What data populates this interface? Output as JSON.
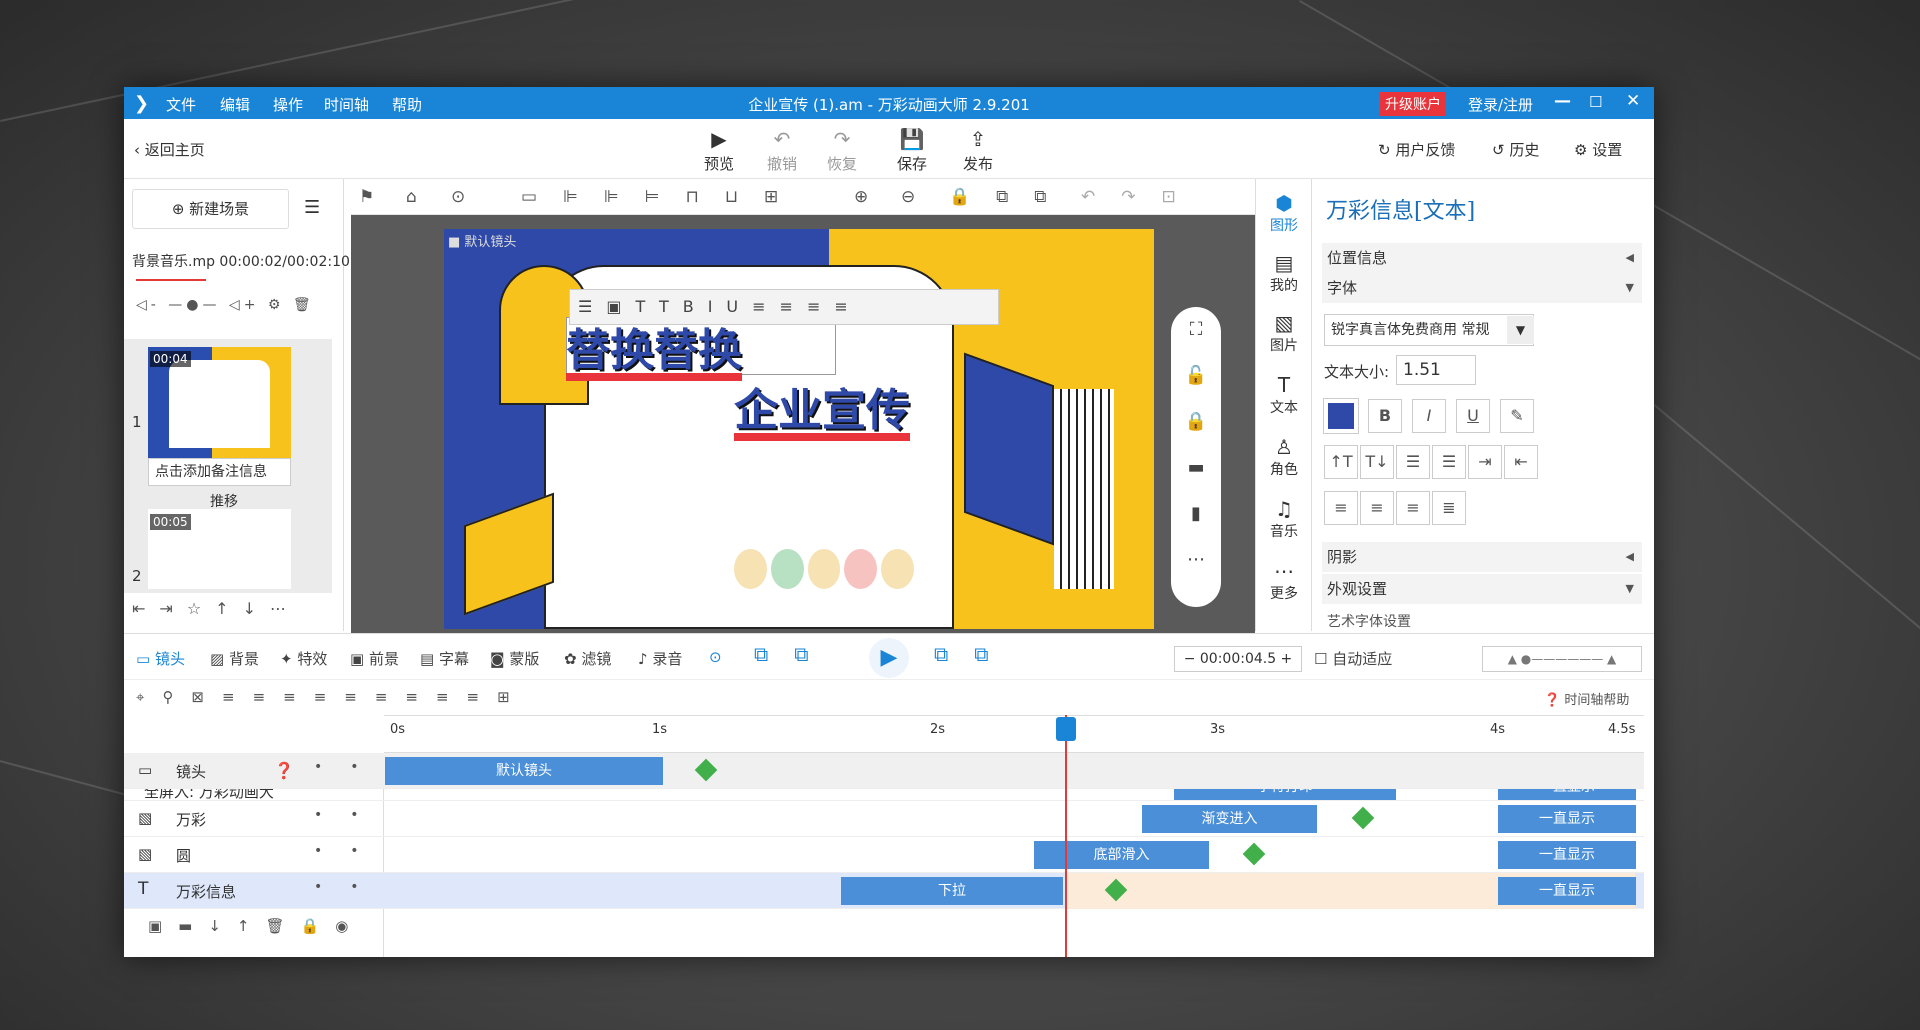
{
  "titlebar": {
    "menu": [
      "文件",
      "编辑",
      "操作",
      "时间轴",
      "帮助"
    ],
    "title": "企业宣传 (1).am - 万彩动画大师 2.9.201",
    "upgrade": "升级账户",
    "login": "登录/注册",
    "minimize": "—",
    "maximize": "☐",
    "close": "✕"
  },
  "toolbar": {
    "back": "返回主页",
    "preview": "预览",
    "undo": "撤销",
    "redo": "恢复",
    "save": "保存",
    "publish": "发布",
    "feedback": "用户反馈",
    "history": "历史",
    "settings": "设置"
  },
  "left": {
    "new_scene": "新建场景",
    "music": "背景音乐.mp  00:00:02/00:02:10",
    "scenes": [
      {
        "num": "1",
        "time": "00:04",
        "note": "点击添加备注信息",
        "transition": "推移"
      },
      {
        "num": "2",
        "time": "00:05"
      }
    ]
  },
  "stage": {
    "camera_label": "默认镜头",
    "text1": "替换替换",
    "text2": "企业宣传"
  },
  "right_icons": [
    "图形",
    "我的",
    "图片",
    "文本",
    "角色",
    "音乐",
    "更多"
  ],
  "props": {
    "title": "万彩信息[文本]",
    "position": "位置信息",
    "font": "字体",
    "font_value": "锐字真言体免费商用 常规",
    "size_label": "文本大小:",
    "size_value": "1.51",
    "shadow": "阴影",
    "appearance": "外观设置",
    "art": "艺术字体设置"
  },
  "tl_controls": {
    "items": [
      "镜头",
      "背景",
      "特效",
      "前景",
      "字幕",
      "蒙版",
      "滤镜",
      "录音"
    ],
    "time": "00:00:04.5",
    "auto": "自动适应",
    "help": "时间轴帮助"
  },
  "ruler": [
    "0s",
    "1s",
    "2s",
    "3s",
    "4s",
    "4.5s"
  ],
  "tracks": [
    {
      "name": "镜头",
      "bars": [
        {
          "label": "默认镜头"
        }
      ]
    },
    {
      "name": "全屏入: 万彩动画大",
      "bars": [
        {
          "label": "字符打印"
        },
        {
          "label": "一直显示"
        }
      ]
    },
    {
      "name": "万彩",
      "bars": [
        {
          "label": "渐变进入"
        },
        {
          "label": "一直显示"
        }
      ]
    },
    {
      "name": "圆",
      "bars": [
        {
          "label": "底部滑入"
        },
        {
          "label": "一直显示"
        }
      ]
    },
    {
      "name": "万彩信息",
      "bars": [
        {
          "label": "下拉"
        },
        {
          "label": "一直显示"
        }
      ]
    }
  ],
  "colors": {
    "accent": "#1a85d6",
    "bar": "#4a8fd8",
    "upgrade": "#e8343a",
    "stage_blue": "#2f49a8",
    "stage_yellow": "#f7c21b"
  }
}
